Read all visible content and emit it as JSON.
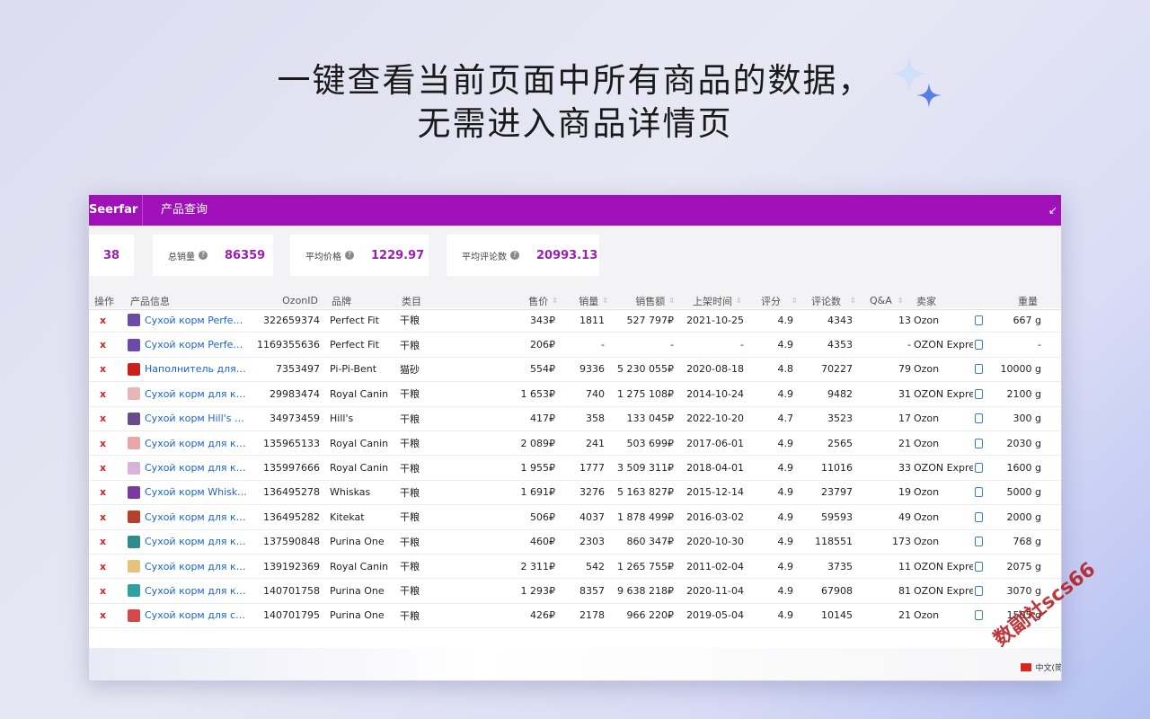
{
  "headline": {
    "line1": "一键查看当前页面中所有商品的数据，",
    "line2": "无需进入商品详情页"
  },
  "app": {
    "brand": "Seerfar",
    "tab": "产品查询",
    "accent": "#a010b8"
  },
  "stats": {
    "count": "38",
    "total_sales_label": "总销量",
    "total_sales_value": "86359",
    "avg_price_label": "平均价格",
    "avg_price_value": "1229.97",
    "avg_reviews_label": "平均评论数",
    "avg_reviews_value": "20993.13"
  },
  "table": {
    "headers": {
      "action": "操作",
      "info": "产品信息",
      "ozonid": "OzonID",
      "brand": "品牌",
      "category": "类目",
      "price": "售价",
      "sales": "销量",
      "revenue": "销售额",
      "listed": "上架时间",
      "rating": "评分",
      "reviews": "评论数",
      "qa": "Q&A",
      "seller": "卖家",
      "weight": "重量"
    },
    "rows": [
      {
        "del": "x",
        "name": "Сухой корм Perfect Fit",
        "id": "322659374",
        "brand": "Perfect Fit",
        "cat": "干粮",
        "price": "343₽",
        "sales": "1811",
        "revenue": "527 797₽",
        "date": "2021-10-25",
        "rating": "4.9",
        "reviews": "4343",
        "qa": "13",
        "seller": "Ozon",
        "weight": "667 g",
        "thumb": "#6d4aa8"
      },
      {
        "del": "x",
        "name": "Сухой корм Perfect Fit",
        "id": "1169355636",
        "brand": "Perfect Fit",
        "cat": "干粮",
        "price": "206₽",
        "sales": "-",
        "revenue": "-",
        "date": "-",
        "rating": "4.9",
        "reviews": "4353",
        "qa": "-",
        "seller": "OZON Express",
        "weight": "-",
        "thumb": "#6d4aa8"
      },
      {
        "del": "x",
        "name": "Наполнитель для кошачьего туалета",
        "id": "7353497",
        "brand": "Pi-Pi-Bent",
        "cat": "猫砂",
        "price": "554₽",
        "sales": "9336",
        "revenue": "5 230 055₽",
        "date": "2020-08-18",
        "rating": "4.8",
        "reviews": "70227",
        "qa": "79",
        "seller": "Ozon",
        "weight": "10000 g",
        "thumb": "#c8201e"
      },
      {
        "del": "x",
        "name": "Сухой корм для котов",
        "id": "29983474",
        "brand": "Royal Canin",
        "cat": "干粮",
        "price": "1 653₽",
        "sales": "740",
        "revenue": "1 275 108₽",
        "date": "2014-10-24",
        "rating": "4.9",
        "reviews": "9482",
        "qa": "31",
        "seller": "OZON Express",
        "weight": "2100 g",
        "thumb": "#e9b6b6"
      },
      {
        "del": "x",
        "name": "Сухой корм Hill's Science Plan",
        "id": "34973459",
        "brand": "Hill's",
        "cat": "干粮",
        "price": "417₽",
        "sales": "358",
        "revenue": "133 045₽",
        "date": "2022-10-20",
        "rating": "4.7",
        "reviews": "3523",
        "qa": "17",
        "seller": "Ozon",
        "weight": "300 g",
        "thumb": "#6a4c8a"
      },
      {
        "del": "x",
        "name": "Сухой корм для котов",
        "id": "135965133",
        "brand": "Royal Canin",
        "cat": "干粮",
        "price": "2 089₽",
        "sales": "241",
        "revenue": "503 699₽",
        "date": "2017-06-01",
        "rating": "4.9",
        "reviews": "2565",
        "qa": "21",
        "seller": "Ozon",
        "weight": "2030 g",
        "thumb": "#e9a6a6"
      },
      {
        "del": "x",
        "name": "Сухой корм для кошек",
        "id": "135997666",
        "brand": "Royal Canin",
        "cat": "干粮",
        "price": "1 955₽",
        "sales": "1777",
        "revenue": "3 509 311₽",
        "date": "2018-04-01",
        "rating": "4.9",
        "reviews": "11016",
        "qa": "33",
        "seller": "OZON Express",
        "weight": "1600 g",
        "thumb": "#d9b3d9"
      },
      {
        "del": "x",
        "name": "Сухой корм Whiskas",
        "id": "136495278",
        "brand": "Whiskas",
        "cat": "干粮",
        "price": "1 691₽",
        "sales": "3276",
        "revenue": "5 163 827₽",
        "date": "2015-12-14",
        "rating": "4.9",
        "reviews": "23797",
        "qa": "19",
        "seller": "Ozon",
        "weight": "5000 g",
        "thumb": "#7a3aa0"
      },
      {
        "del": "x",
        "name": "Сухой корм для кошек",
        "id": "136495282",
        "brand": "Kitekat",
        "cat": "干粮",
        "price": "506₽",
        "sales": "4037",
        "revenue": "1 878 499₽",
        "date": "2016-03-02",
        "rating": "4.9",
        "reviews": "59593",
        "qa": "49",
        "seller": "Ozon",
        "weight": "2000 g",
        "thumb": "#b5402c"
      },
      {
        "del": "x",
        "name": "Сухой корм для кошек",
        "id": "137590848",
        "brand": "Purina One",
        "cat": "干粮",
        "price": "460₽",
        "sales": "2303",
        "revenue": "860 347₽",
        "date": "2020-10-30",
        "rating": "4.9",
        "reviews": "118551",
        "qa": "173",
        "seller": "Ozon",
        "weight": "768 g",
        "thumb": "#2e8c8c"
      },
      {
        "del": "x",
        "name": "Сухой корм для кошек",
        "id": "139192369",
        "brand": "Royal Canin",
        "cat": "干粮",
        "price": "2 311₽",
        "sales": "542",
        "revenue": "1 265 755₽",
        "date": "2011-02-04",
        "rating": "4.9",
        "reviews": "3735",
        "qa": "11",
        "seller": "OZON Express",
        "weight": "2075 g",
        "thumb": "#e8c27a"
      },
      {
        "del": "x",
        "name": "Сухой корм для кошек",
        "id": "140701758",
        "brand": "Purina One",
        "cat": "干粮",
        "price": "1 293₽",
        "sales": "8357",
        "revenue": "9 638 218₽",
        "date": "2020-11-04",
        "rating": "4.9",
        "reviews": "67908",
        "qa": "81",
        "seller": "OZON Express",
        "weight": "3070 g",
        "thumb": "#2ea0a0"
      },
      {
        "del": "x",
        "name": "Сухой корм для собак",
        "id": "140701795",
        "brand": "Purina One",
        "cat": "干粮",
        "price": "426₽",
        "sales": "2178",
        "revenue": "966 220₽",
        "date": "2019-05-04",
        "rating": "4.9",
        "reviews": "10145",
        "qa": "21",
        "seller": "Ozon",
        "weight": "1505 g",
        "thumb": "#d34a4a"
      }
    ]
  },
  "footer": {
    "language": "中文(简"
  },
  "watermark": "数副社scs66"
}
